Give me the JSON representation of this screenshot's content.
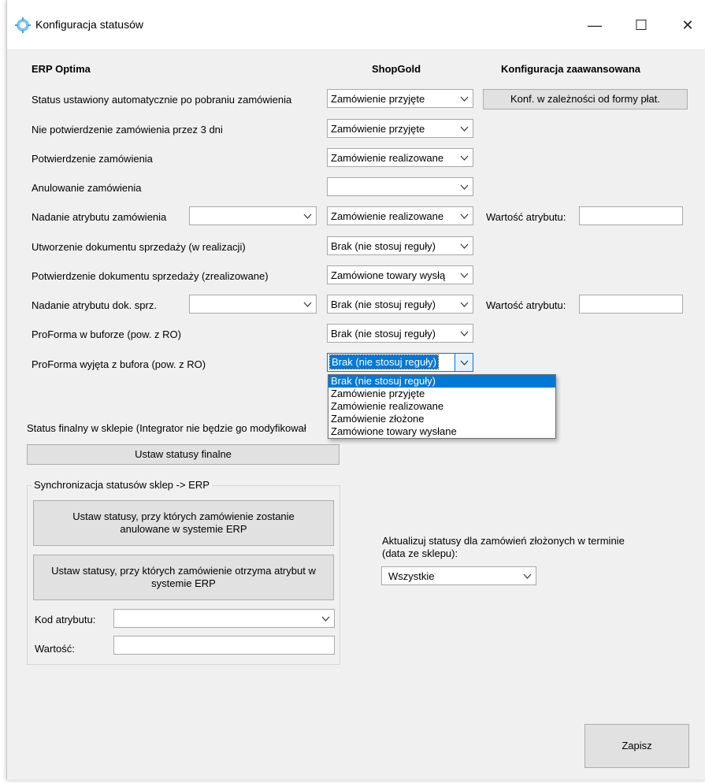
{
  "window": {
    "title": "Konfiguracja statusów",
    "controls": {
      "minimize": "—",
      "maximize": "☐",
      "close": "✕"
    }
  },
  "headers": {
    "erp": "ERP Optima",
    "shop": "ShopGold",
    "advanced": "Konfiguracja zaawansowana"
  },
  "rows": [
    {
      "label": "Status ustawiony automatycznie po pobraniu zamówienia",
      "value": "Zamówienie przyjęte"
    },
    {
      "label": "Nie potwierdzenie zamówienia przez 3 dni",
      "value": "Zamówienie przyjęte"
    },
    {
      "label": "Potwierdzenie zamówienia",
      "value": "Zamówienie realizowane"
    },
    {
      "label": "Anulowanie zamówienia",
      "value": ""
    },
    {
      "label": "Nadanie atrybutu zamówienia",
      "value": "Zamówienie realizowane",
      "attr_combo": "",
      "attr_label": "Wartość atrybutu:",
      "attr_value": ""
    },
    {
      "label": "Utworzenie dokumentu sprzedaży (w realizacji)",
      "value": "Brak (nie stosuj reguły)"
    },
    {
      "label": "Potwierdzenie dokumentu sprzedaży (zrealizowane)",
      "value": "Zamówione towary wysłą"
    },
    {
      "label": "Nadanie atrybutu dok. sprz.",
      "value": "Brak (nie stosuj reguły)",
      "attr_combo": "",
      "attr_label": "Wartość atrybutu:",
      "attr_value": ""
    },
    {
      "label": "ProForma w buforze (pow. z RO)",
      "value": "Brak (nie stosuj reguły)"
    },
    {
      "label": "ProForma wyjęta z bufora (pow. z RO)",
      "value": "Brak (nie stosuj reguły)"
    }
  ],
  "advanced_button": "Konf. w zależności od formy płat.",
  "dropdown_options": [
    "Brak (nie stosuj reguły)",
    "Zamówienie przyjęte",
    "Zamówienie realizowane",
    "Zamówienie złożone",
    "Zamówione towary wysłane"
  ],
  "final_status": {
    "label": "Status finalny w sklepie (Integrator nie będzie go modyfikował",
    "button": "Ustaw statusy finalne"
  },
  "sync_group": {
    "title": "Synchronizacja statusów sklep -> ERP",
    "cancel_button_line1": "Ustaw statusy, przy których zamówienie zostanie",
    "cancel_button_line2": "anulowane w systemie ERP",
    "attr_button_line1": "Ustaw statusy, przy których zamówienie otrzyma atrybut w",
    "attr_button_line2": "systemie ERP",
    "attr_code_label": "Kod atrybutu:",
    "attr_code_value": "",
    "value_label": "Wartość:",
    "value_value": ""
  },
  "update": {
    "label_line1": "Aktualizuj statusy dla zamówień złożonych w terminie",
    "label_line2": "(data ze sklepu):",
    "value": "Wszystkie"
  },
  "save_button": "Zapisz"
}
